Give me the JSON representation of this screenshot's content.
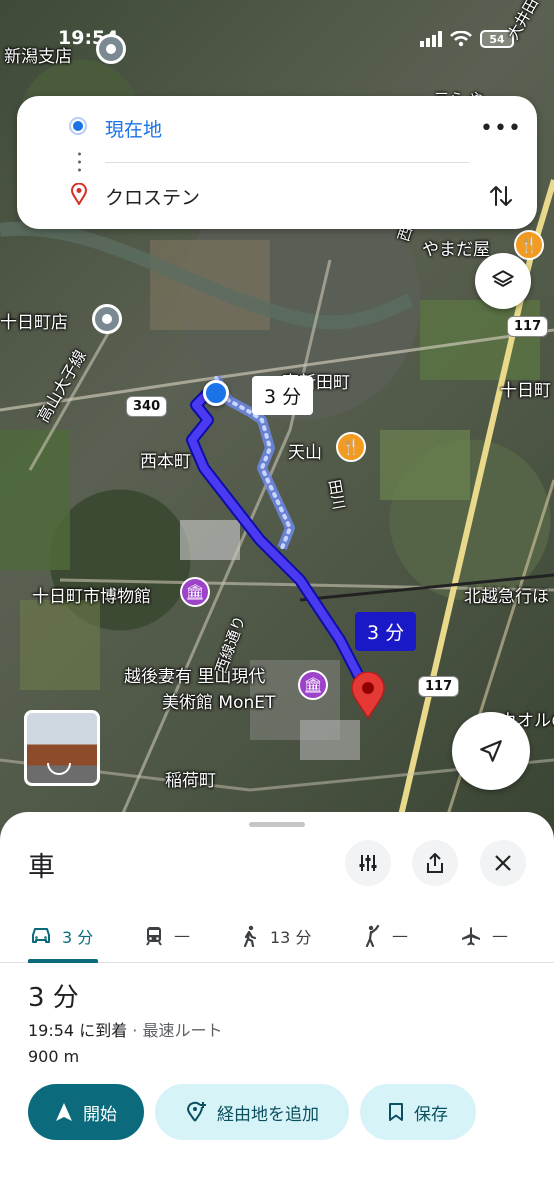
{
  "status_bar": {
    "time": "19:54",
    "battery": "54"
  },
  "search": {
    "origin": "現在地",
    "destination": "クロステン",
    "more_label": "•••"
  },
  "map": {
    "labels": {
      "niigata_shop": "新潟支店",
      "tokamachi_shop": "十日町店",
      "nishihoncho": "西本町",
      "higashi_shinden": "東新田町",
      "tenzan": "天山",
      "museum": "十日町市博物館",
      "echigo_art_1": "越後妻有 里山現代",
      "echigo_art_2": "美術館 MonET",
      "inaricho": "稲荷町",
      "yamadaya": "やまだ屋",
      "tokamachi_right": "十日町",
      "hokuetsu": "北越急行ほ",
      "takayama_road": "高山大子線",
      "nishiki_dori": "西線通り",
      "tagawa": "田川",
      "nishi_top": "西線",
      "top_right": "大井田",
      "top_right2": "三ら や",
      "bottom_right": "カオルの"
    },
    "route_signs": {
      "r340": "340",
      "r117a": "117",
      "r117b": "117"
    },
    "bubbles": {
      "alt": "3 分",
      "main": "3 分"
    }
  },
  "sheet": {
    "title": "車",
    "tabs": [
      {
        "label": "3 分"
      },
      {
        "label": "—"
      },
      {
        "label": "13 分"
      },
      {
        "label": "—"
      },
      {
        "label": "—"
      }
    ],
    "duration": "3 分",
    "arrival": "19:54 に到着",
    "arrival_sub": " · 最速ルート",
    "distance": "900 m",
    "buttons": {
      "start": "開始",
      "add_stop": "経由地を追加",
      "save": "保存"
    }
  },
  "colors": {
    "accent": "#0b6b7c",
    "route": "#1a19c8",
    "origin": "#1a73e8",
    "pin": "#e53935"
  }
}
